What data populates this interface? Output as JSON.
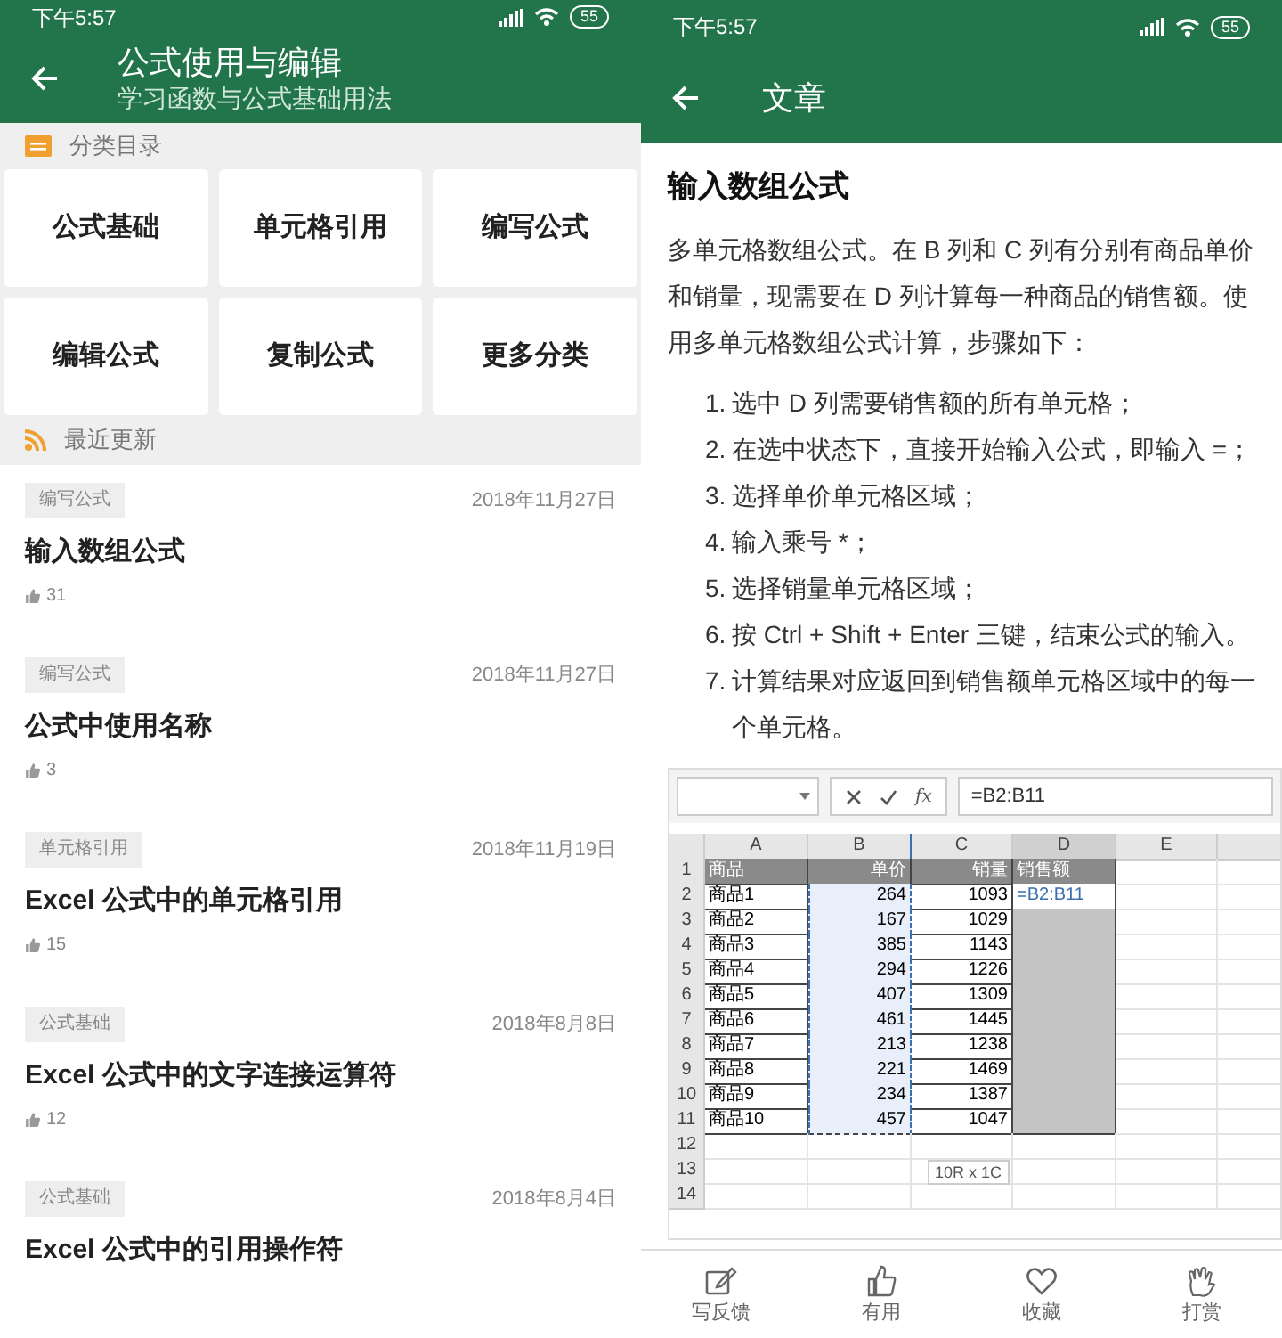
{
  "left": {
    "status_bar": {
      "time": "下午5:57",
      "battery": "55"
    },
    "header": {
      "title": "公式使用与编辑",
      "subtitle": "学习函数与公式基础用法"
    },
    "categories": {
      "heading": "分类目录",
      "items": [
        "公式基础",
        "单元格引用",
        "编写公式",
        "编辑公式",
        "复制公式",
        "更多分类"
      ]
    },
    "recent": {
      "heading": "最近更新",
      "articles": [
        {
          "tag": "编写公式",
          "date": "2018年11月27日",
          "title": "输入数组公式",
          "likes": "31"
        },
        {
          "tag": "编写公式",
          "date": "2018年11月27日",
          "title": "公式中使用名称",
          "likes": "3"
        },
        {
          "tag": "单元格引用",
          "date": "2018年11月19日",
          "title": "Excel 公式中的单元格引用",
          "likes": "15"
        },
        {
          "tag": "公式基础",
          "date": "2018年8月8日",
          "title": "Excel 公式中的文字连接运算符",
          "likes": "12"
        },
        {
          "tag": "公式基础",
          "date": "2018年8月4日",
          "title": "Excel 公式中的引用操作符"
        }
      ]
    }
  },
  "right": {
    "status_bar": {
      "time": "下午5:57",
      "battery": "55"
    },
    "header": {
      "title": "文章"
    },
    "article": {
      "title": "输入数组公式",
      "intro": "多单元格数组公式。在 B 列和 C 列有分别有商品单价和销量，现需要在 D 列计算每一种商品的销售额。使用多单元格数组公式计算，步骤如下：",
      "steps": [
        {
          "number": "1.",
          "text": "选中 D 列需要销售额的所有单元格；"
        },
        {
          "number": "2.",
          "text": "在选中状态下，直接开始输入公式，即输入 =；"
        },
        {
          "number": "3.",
          "text": "选择单价单元格区域；"
        },
        {
          "number": "4.",
          "text": "输入乘号 *；"
        },
        {
          "number": "5.",
          "text": "选择销量单元格区域；"
        },
        {
          "number": "6.",
          "text": "按 Ctrl + Shift + Enter 三键，结束公式的输入。"
        },
        {
          "number": "7.",
          "text": "计算结果对应返回到销售额单元格区域中的每一个单元格。"
        }
      ]
    },
    "spreadsheet": {
      "function_label": "fx",
      "formula": "=B2:B11",
      "columns": [
        {
          "label": "A",
          "marquee": false,
          "selected": false
        },
        {
          "label": "B",
          "marquee": true,
          "selected": false
        },
        {
          "label": "C",
          "marquee": false,
          "selected": false
        },
        {
          "label": "D",
          "marquee": false,
          "selected": true
        },
        {
          "label": "E",
          "marquee": false,
          "selected": false
        }
      ],
      "rows": [
        {
          "number": "1",
          "cells": [
            "商品",
            "单价",
            "销量",
            "销售额"
          ]
        },
        {
          "number": "2",
          "cells": [
            "商品1",
            "264",
            "1093",
            "=B2:B11"
          ]
        },
        {
          "number": "3",
          "cells": [
            "商品2",
            "167",
            "1029"
          ]
        },
        {
          "number": "4",
          "cells": [
            "商品3",
            "385",
            "1143"
          ]
        },
        {
          "number": "5",
          "cells": [
            "商品4",
            "294",
            "1226"
          ]
        },
        {
          "number": "6",
          "cells": [
            "商品5",
            "407",
            "1309"
          ]
        },
        {
          "number": "7",
          "cells": [
            "商品6",
            "461",
            "1445"
          ]
        },
        {
          "number": "8",
          "cells": [
            "商品7",
            "213",
            "1238"
          ]
        },
        {
          "number": "9",
          "cells": [
            "商品8",
            "221",
            "1469"
          ]
        },
        {
          "number": "10",
          "cells": [
            "商品9",
            "234",
            "1387"
          ]
        },
        {
          "number": "11",
          "cells": [
            "商品10",
            "457",
            "1047"
          ]
        },
        {
          "number": "12"
        },
        {
          "number": "13"
        },
        {
          "number": "14"
        }
      ],
      "tooltip": "10R x 1C"
    },
    "actions": [
      {
        "kind": "feedback",
        "label": "写反馈"
      },
      {
        "kind": "like",
        "label": "有用"
      },
      {
        "kind": "favorite",
        "label": "收藏"
      },
      {
        "kind": "tip",
        "label": "打赏"
      }
    ]
  }
}
